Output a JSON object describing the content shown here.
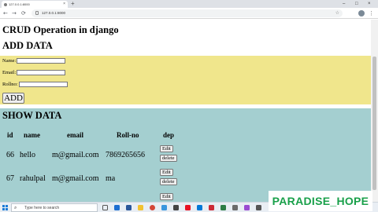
{
  "browser": {
    "tab_title": "127.0.0.1:8000",
    "new_tab": "+",
    "window_controls": [
      "–",
      "□",
      "×"
    ],
    "url": "127.0.0.1:8000",
    "nav": {
      "back": "←",
      "forward": "→",
      "reload": "⟳"
    }
  },
  "page": {
    "title": "CRUD Operation in django",
    "add_heading": "ADD DATA",
    "form": {
      "name_label": "Name:",
      "email_label": "Email:",
      "rollno_label": "Rollno:",
      "add_button": "ADD"
    },
    "show_heading": "SHOW DATA",
    "table": {
      "headers": [
        "id",
        "name",
        "email",
        "Roll-no",
        "dep"
      ],
      "rows": [
        {
          "id": "66",
          "name": "hello",
          "email": "m@gmail.com",
          "rollno": "7869265656",
          "edit": "Edit",
          "delete": "delete"
        },
        {
          "id": "67",
          "name": "rahulpal",
          "email": "m@gmail.com",
          "rollno": "ma",
          "edit": "Edit",
          "delete": "delete"
        },
        {
          "edit": "Edit"
        }
      ]
    }
  },
  "taskbar": {
    "search_placeholder": "Type here to search"
  },
  "watermark": "PARADISE_HOPE",
  "colors": {
    "add_bg": "#f0e68c",
    "show_bg": "#a4cfd0",
    "watermark": "#19a04a"
  }
}
